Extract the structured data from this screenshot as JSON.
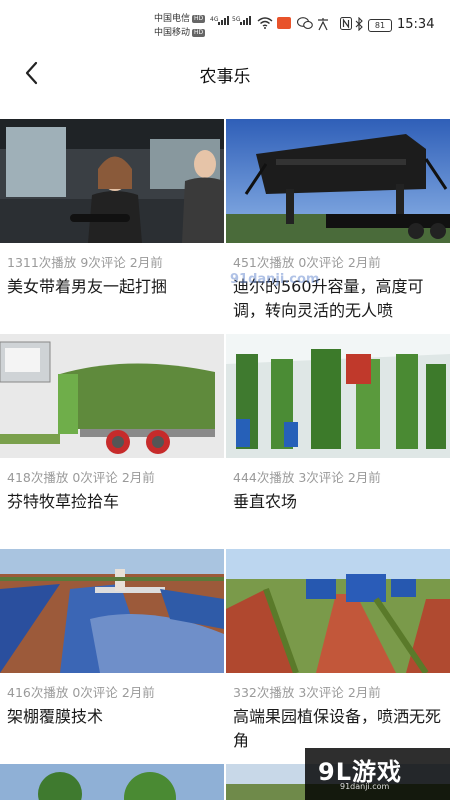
{
  "status": {
    "carrier1": "中国电信",
    "carrier2": "中国移动",
    "hd": "HD",
    "net1": "4G",
    "net2": "5G",
    "battery": "81",
    "time": "15:34"
  },
  "header": {
    "title": "农事乐"
  },
  "videos": [
    {
      "plays": "1311次播放",
      "comments": "9次评论",
      "age": "2月前",
      "title": "美女带着男友一起打捆"
    },
    {
      "plays": "451次播放",
      "comments": "0次评论",
      "age": "2月前",
      "title": "迪尔的560升容量，高度可调，转向灵活的无人喷"
    },
    {
      "plays": "418次播放",
      "comments": "0次评论",
      "age": "2月前",
      "title": "芬特牧草捡拾车"
    },
    {
      "plays": "444次播放",
      "comments": "3次评论",
      "age": "2月前",
      "title": "垂直农场"
    },
    {
      "plays": "416次播放",
      "comments": "0次评论",
      "age": "2月前",
      "title": "架棚覆膜技术"
    },
    {
      "plays": "332次播放",
      "comments": "3次评论",
      "age": "2月前",
      "title": "高端果园植保设备，喷洒无死角"
    }
  ],
  "watermark": {
    "brand": "9L游戏",
    "site": "91danji.com"
  },
  "colors": {
    "meta": "#9a9a9a",
    "title": "#1a1a1a",
    "background": "#ffffff"
  }
}
